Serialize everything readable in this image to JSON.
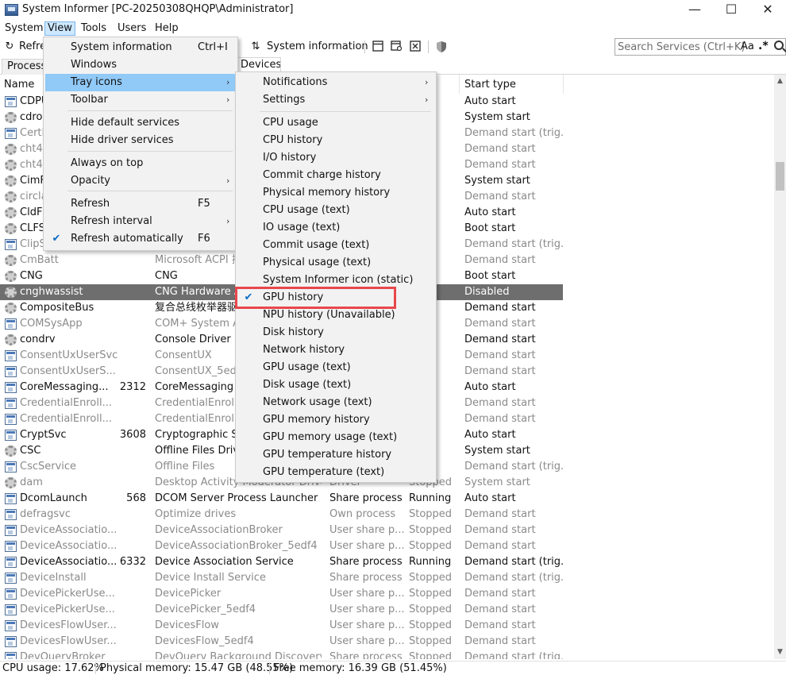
{
  "window": {
    "title": "System Informer [PC-20250308QHQP\\Administrator]",
    "minimize": "—",
    "maximize": "☐",
    "close": "✕"
  },
  "menubar": [
    "System",
    "View",
    "Tools",
    "Users",
    "Help"
  ],
  "toolbar": {
    "refresh": "Refre",
    "system_information": "System information",
    "refresh_glyph": "↻",
    "sysinfo_glyph": "⇅"
  },
  "search": {
    "placeholder": "Search Services (Ctrl+K)",
    "case_label": "Aa",
    "regex_label": ".*"
  },
  "tabs": [
    "Processe",
    "Devices"
  ],
  "table": {
    "headers": {
      "name": "Name",
      "start_type": "Start type"
    },
    "rows": [
      {
        "icon": "service",
        "name": "CDPU",
        "pid": "",
        "display": "",
        "type": "",
        "status": "ng",
        "start": "Auto start",
        "gray": false,
        "selected": false
      },
      {
        "icon": "driver",
        "name": "cdror",
        "pid": "",
        "display": "",
        "type": "",
        "status": "ng",
        "start": "System start",
        "gray": false,
        "selected": false
      },
      {
        "icon": "service",
        "name": "CertP",
        "pid": "",
        "display": "",
        "type": "",
        "status": "ed",
        "start": "Demand start (trig...",
        "gray": true,
        "selected": false
      },
      {
        "icon": "driver",
        "name": "cht4is",
        "pid": "",
        "display": "",
        "type": "",
        "status": "ed",
        "start": "Demand start",
        "gray": true,
        "selected": false
      },
      {
        "icon": "driver",
        "name": "cht4v",
        "pid": "",
        "display": "",
        "type": "",
        "status": "ed",
        "start": "Demand start",
        "gray": true,
        "selected": false
      },
      {
        "icon": "driver",
        "name": "CimF",
        "pid": "",
        "display": "",
        "type": "",
        "status": "ng",
        "start": "System start",
        "gray": false,
        "selected": false
      },
      {
        "icon": "driver",
        "name": "circla",
        "pid": "",
        "display": "",
        "type": "",
        "status": "ed",
        "start": "Demand start",
        "gray": true,
        "selected": false
      },
      {
        "icon": "driver",
        "name": "CldFl",
        "pid": "",
        "display": "",
        "type": "",
        "status": "ng",
        "start": "Auto start",
        "gray": false,
        "selected": false
      },
      {
        "icon": "driver",
        "name": "CLFS",
        "pid": "",
        "display": "",
        "type": "",
        "status": "ng",
        "start": "Boot start",
        "gray": false,
        "selected": false
      },
      {
        "icon": "service",
        "name": "ClipS",
        "pid": "",
        "display": "",
        "type": "",
        "status": "ed",
        "start": "Demand start (trig...",
        "gray": true,
        "selected": false
      },
      {
        "icon": "driver",
        "name": "CmBatt",
        "pid": "",
        "display": "Microsoft ACPI 控",
        "type": "",
        "status": "ed",
        "start": "Demand start",
        "gray": true,
        "selected": false
      },
      {
        "icon": "driver",
        "name": "CNG",
        "pid": "",
        "display": "CNG",
        "type": "",
        "status": "ng",
        "start": "Boot start",
        "gray": false,
        "selected": false
      },
      {
        "icon": "driver",
        "name": "cnghwassist",
        "pid": "",
        "display": "CNG Hardware A",
        "type": "",
        "status": "ed",
        "start": "Disabled",
        "gray": false,
        "selected": true
      },
      {
        "icon": "driver",
        "name": "CompositeBus",
        "pid": "",
        "display": "复合总线枚举器驱动",
        "type": "",
        "status": "ng",
        "start": "Demand start",
        "gray": false,
        "selected": false
      },
      {
        "icon": "service",
        "name": "COMSysApp",
        "pid": "",
        "display": "COM+ System Ap",
        "type": "",
        "status": "ed",
        "start": "Demand start",
        "gray": true,
        "selected": false
      },
      {
        "icon": "driver",
        "name": "condrv",
        "pid": "",
        "display": "Console Driver",
        "type": "",
        "status": "ng",
        "start": "Demand start",
        "gray": false,
        "selected": false
      },
      {
        "icon": "service",
        "name": "ConsentUxUserSvc",
        "pid": "",
        "display": "ConsentUX",
        "type": "",
        "status": "ed",
        "start": "Demand start",
        "gray": true,
        "selected": false
      },
      {
        "icon": "service",
        "name": "ConsentUxUserS...",
        "pid": "",
        "display": "ConsentUX_5edf4",
        "type": "",
        "status": "ed",
        "start": "Demand start",
        "gray": true,
        "selected": false
      },
      {
        "icon": "service",
        "name": "CoreMessaging...",
        "pid": "2312",
        "display": "CoreMessaging",
        "type": "",
        "status": "ng",
        "start": "Auto start",
        "gray": false,
        "selected": false
      },
      {
        "icon": "service",
        "name": "CredentialEnroll...",
        "pid": "",
        "display": "CredentialEnroll",
        "type": "",
        "status": "ed",
        "start": "Demand start",
        "gray": true,
        "selected": false
      },
      {
        "icon": "service",
        "name": "CredentialEnroll...",
        "pid": "",
        "display": "CredentialEnroll",
        "type": "",
        "status": "ed",
        "start": "Demand start",
        "gray": true,
        "selected": false
      },
      {
        "icon": "service",
        "name": "CryptSvc",
        "pid": "3608",
        "display": "Cryptographic Se",
        "type": "",
        "status": "ng",
        "start": "Auto start",
        "gray": false,
        "selected": false
      },
      {
        "icon": "driver",
        "name": "CSC",
        "pid": "",
        "display": "Offline Files Drive",
        "type": "",
        "status": "ng",
        "start": "System start",
        "gray": false,
        "selected": false
      },
      {
        "icon": "service",
        "name": "CscService",
        "pid": "",
        "display": "Offline Files",
        "type": "",
        "status": "ed",
        "start": "Demand start (trig...",
        "gray": true,
        "selected": false
      },
      {
        "icon": "driver",
        "name": "dam",
        "pid": "",
        "display": "Desktop Activity Moderator Driver",
        "type": "Driver",
        "status": "Stopped",
        "start": "System start",
        "gray": true,
        "selected": false
      },
      {
        "icon": "service",
        "name": "DcomLaunch",
        "pid": "568",
        "display": "DCOM Server Process Launcher",
        "type": "Share process",
        "status": "Running",
        "start": "Auto start",
        "gray": false,
        "selected": false
      },
      {
        "icon": "service",
        "name": "defragsvc",
        "pid": "",
        "display": "Optimize drives",
        "type": "Own process",
        "status": "Stopped",
        "start": "Demand start",
        "gray": true,
        "selected": false
      },
      {
        "icon": "service",
        "name": "DeviceAssociatio...",
        "pid": "",
        "display": "DeviceAssociationBroker",
        "type": "User share p...",
        "status": "Stopped",
        "start": "Demand start",
        "gray": true,
        "selected": false
      },
      {
        "icon": "service",
        "name": "DeviceAssociatio...",
        "pid": "",
        "display": "DeviceAssociationBroker_5edf4",
        "type": "User share p...",
        "status": "Stopped",
        "start": "Demand start",
        "gray": true,
        "selected": false
      },
      {
        "icon": "service",
        "name": "DeviceAssociatio...",
        "pid": "6332",
        "display": "Device Association Service",
        "type": "Share process",
        "status": "Running",
        "start": "Demand start (trig...",
        "gray": false,
        "selected": false
      },
      {
        "icon": "service",
        "name": "DeviceInstall",
        "pid": "",
        "display": "Device Install Service",
        "type": "Share process",
        "status": "Stopped",
        "start": "Demand start (trig...",
        "gray": true,
        "selected": false
      },
      {
        "icon": "service",
        "name": "DevicePickerUse...",
        "pid": "",
        "display": "DevicePicker",
        "type": "User share p...",
        "status": "Stopped",
        "start": "Demand start",
        "gray": true,
        "selected": false
      },
      {
        "icon": "service",
        "name": "DevicePickerUse...",
        "pid": "",
        "display": "DevicePicker_5edf4",
        "type": "User share p...",
        "status": "Stopped",
        "start": "Demand start",
        "gray": true,
        "selected": false
      },
      {
        "icon": "service",
        "name": "DevicesFlowUser...",
        "pid": "",
        "display": "DevicesFlow",
        "type": "User share p...",
        "status": "Stopped",
        "start": "Demand start",
        "gray": true,
        "selected": false
      },
      {
        "icon": "service",
        "name": "DevicesFlowUser...",
        "pid": "",
        "display": "DevicesFlow_5edf4",
        "type": "User share p...",
        "status": "Stopped",
        "start": "Demand start",
        "gray": true,
        "selected": false
      },
      {
        "icon": "service",
        "name": "DevQueryBroker",
        "pid": "",
        "display": "DevQuery Background Discovery ...",
        "type": "Share process",
        "status": "Stopped",
        "start": "Demand start (trig...",
        "gray": true,
        "selected": false
      }
    ]
  },
  "view_menu": {
    "items": [
      {
        "label": "System information",
        "accel": "Ctrl+I",
        "arrow": false,
        "checked": false,
        "highlighted": false
      },
      {
        "label": "Windows",
        "accel": "",
        "arrow": false,
        "checked": false,
        "highlighted": false
      },
      {
        "label": "Tray icons",
        "accel": "",
        "arrow": true,
        "checked": false,
        "highlighted": true
      },
      {
        "label": "Toolbar",
        "accel": "",
        "arrow": true,
        "checked": false,
        "highlighted": false
      },
      {
        "label": "Hide default services",
        "accel": "",
        "arrow": false,
        "checked": false,
        "highlighted": false
      },
      {
        "label": "Hide driver services",
        "accel": "",
        "arrow": false,
        "checked": false,
        "highlighted": false
      },
      {
        "label": "Always on top",
        "accel": "",
        "arrow": false,
        "checked": false,
        "highlighted": false
      },
      {
        "label": "Opacity",
        "accel": "",
        "arrow": true,
        "checked": false,
        "highlighted": false
      },
      {
        "label": "Refresh",
        "accel": "F5",
        "arrow": false,
        "checked": false,
        "highlighted": false
      },
      {
        "label": "Refresh interval",
        "accel": "",
        "arrow": true,
        "checked": false,
        "highlighted": false
      },
      {
        "label": "Refresh automatically",
        "accel": "F6",
        "arrow": false,
        "checked": true,
        "highlighted": false
      }
    ]
  },
  "tray_menu": {
    "items": [
      {
        "label": "Notifications",
        "arrow": true,
        "checked": false
      },
      {
        "label": "Settings",
        "arrow": true,
        "checked": false
      },
      {
        "label": "CPU usage",
        "arrow": false,
        "checked": false
      },
      {
        "label": "CPU history",
        "arrow": false,
        "checked": false
      },
      {
        "label": "I/O history",
        "arrow": false,
        "checked": false
      },
      {
        "label": "Commit charge history",
        "arrow": false,
        "checked": false
      },
      {
        "label": "Physical memory history",
        "arrow": false,
        "checked": false
      },
      {
        "label": "CPU usage (text)",
        "arrow": false,
        "checked": false
      },
      {
        "label": "IO usage (text)",
        "arrow": false,
        "checked": false
      },
      {
        "label": "Commit usage (text)",
        "arrow": false,
        "checked": false
      },
      {
        "label": "Physical usage (text)",
        "arrow": false,
        "checked": false
      },
      {
        "label": "System Informer icon (static)",
        "arrow": false,
        "checked": false
      },
      {
        "label": "GPU history",
        "arrow": false,
        "checked": true
      },
      {
        "label": "NPU history (Unavailable)",
        "arrow": false,
        "checked": false
      },
      {
        "label": "Disk history",
        "arrow": false,
        "checked": false
      },
      {
        "label": "Network history",
        "arrow": false,
        "checked": false
      },
      {
        "label": "GPU usage (text)",
        "arrow": false,
        "checked": false
      },
      {
        "label": "Disk usage (text)",
        "arrow": false,
        "checked": false
      },
      {
        "label": "Network usage (text)",
        "arrow": false,
        "checked": false
      },
      {
        "label": "GPU memory history",
        "arrow": false,
        "checked": false
      },
      {
        "label": "GPU memory usage (text)",
        "arrow": false,
        "checked": false
      },
      {
        "label": "GPU temperature history",
        "arrow": false,
        "checked": false
      },
      {
        "label": "GPU temperature (text)",
        "arrow": false,
        "checked": false
      }
    ]
  },
  "statusbar": {
    "cpu": "CPU usage: 17.62%",
    "physical": "Physical memory: 15.47 GB (48.55%)",
    "free": "Free memory: 16.39 GB (51.45%)"
  },
  "colors": {
    "menu_highlight": "#91c9f7",
    "selected_row": "#6e6e6e",
    "highlight_box": "#e8474b",
    "check": "#0b6dc5"
  }
}
